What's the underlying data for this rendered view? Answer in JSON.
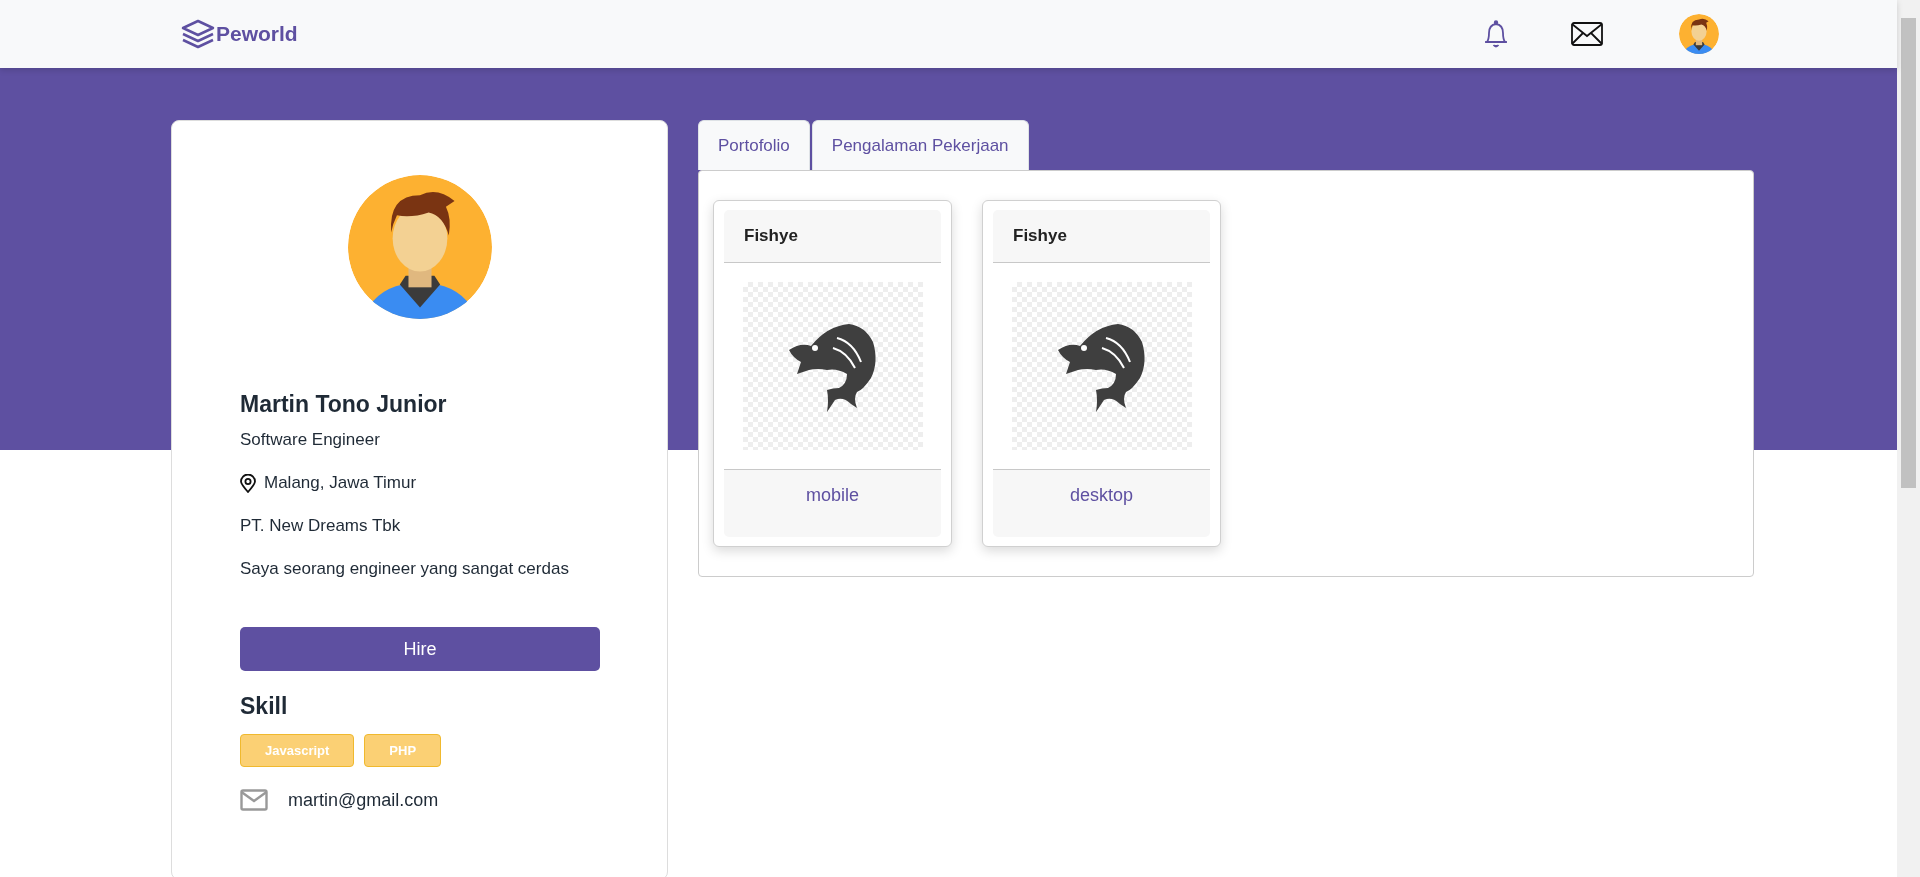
{
  "navbar": {
    "brand": "Peworld"
  },
  "profile": {
    "name": "Martin Tono Junior",
    "job": "Software Engineer",
    "location": "Malang, Jawa Timur",
    "company": "PT. New Dreams Tbk",
    "bio": "Saya seorang engineer yang sangat cerdas",
    "hire_button": "Hire",
    "skill_title": "Skill",
    "skills": [
      "Javascript",
      "PHP"
    ],
    "email": "martin@gmail.com"
  },
  "tabs": [
    {
      "label": "Portofolio"
    },
    {
      "label": "Pengalaman Pekerjaan"
    }
  ],
  "portfolio": [
    {
      "title": "Fishye",
      "type": "mobile"
    },
    {
      "title": "Fishye",
      "type": "desktop"
    }
  ]
}
